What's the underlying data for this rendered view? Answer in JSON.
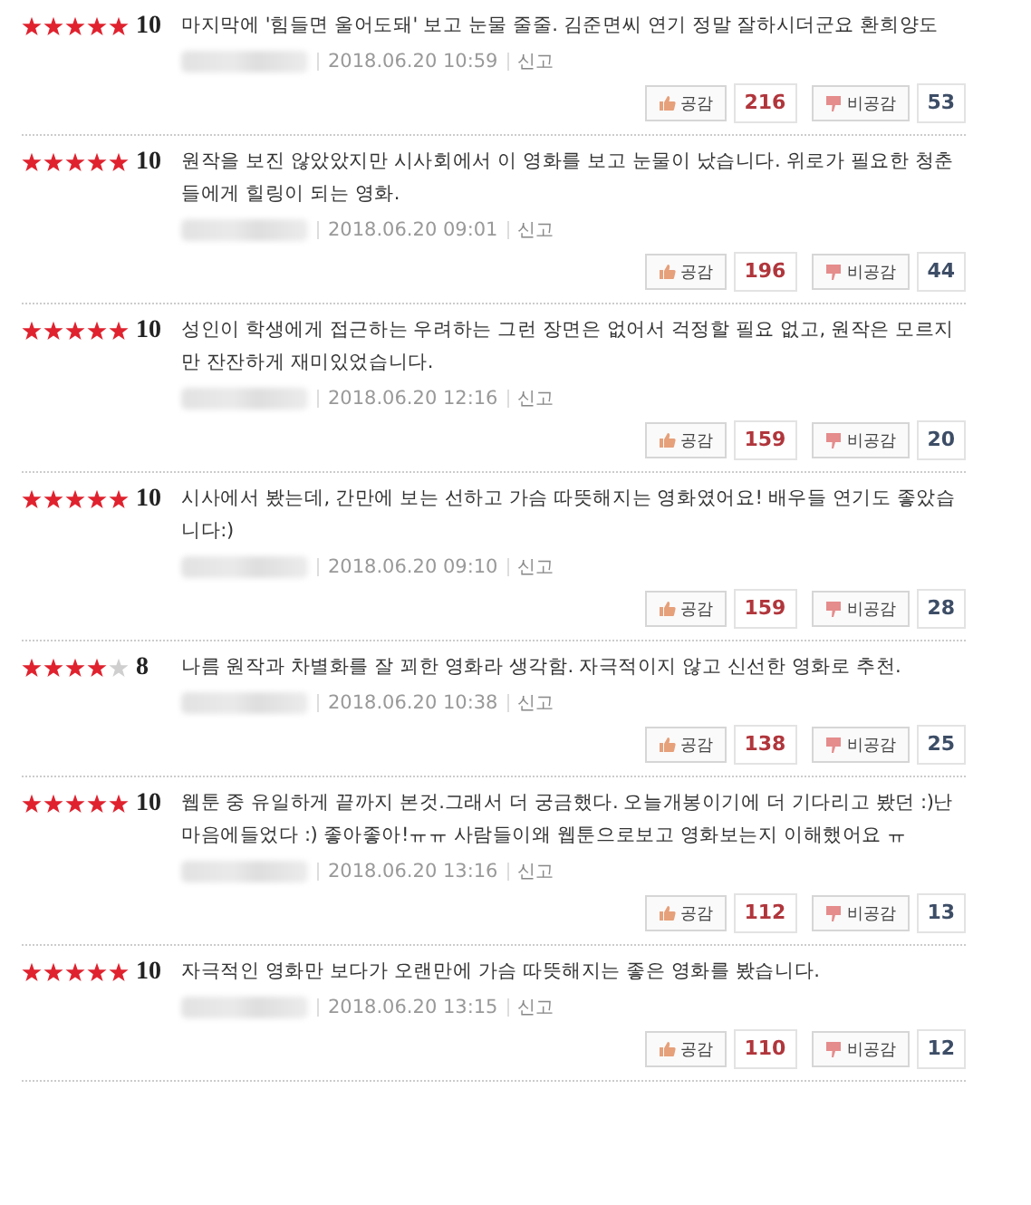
{
  "reviews": [
    {
      "stars": 5,
      "score": "10",
      "text": "마지막에 '힘들면 울어도돼' 보고 눈물 줄줄. 김준면씨 연기 정말 잘하시더군요 환희양도",
      "date": "2018.06.20 10:59",
      "report": "신고",
      "like_label": "공감",
      "likes": "216",
      "dislike_label": "비공감",
      "dislikes": "53"
    },
    {
      "stars": 5,
      "score": "10",
      "text": "원작을 보진 않았았지만 시사회에서 이 영화를 보고 눈물이 났습니다. 위로가 필요한 청춘들에게 힐링이 되는 영화.",
      "date": "2018.06.20 09:01",
      "report": "신고",
      "like_label": "공감",
      "likes": "196",
      "dislike_label": "비공감",
      "dislikes": "44"
    },
    {
      "stars": 5,
      "score": "10",
      "text": "성인이 학생에게 접근하는 우려하는 그런 장면은 없어서 걱정할 필요 없고, 원작은 모르지만 잔잔하게 재미있었습니다.",
      "date": "2018.06.20 12:16",
      "report": "신고",
      "like_label": "공감",
      "likes": "159",
      "dislike_label": "비공감",
      "dislikes": "20"
    },
    {
      "stars": 5,
      "score": "10",
      "text": "시사에서 봤는데, 간만에 보는 선하고 가슴 따뜻해지는 영화였어요! 배우들 연기도 좋았습니다:)",
      "date": "2018.06.20 09:10",
      "report": "신고",
      "like_label": "공감",
      "likes": "159",
      "dislike_label": "비공감",
      "dislikes": "28"
    },
    {
      "stars": 4,
      "score": "8",
      "text": "나름 원작과 차별화를 잘 꾀한 영화라 생각함. 자극적이지 않고 신선한 영화로 추천.",
      "date": "2018.06.20 10:38",
      "report": "신고",
      "like_label": "공감",
      "likes": "138",
      "dislike_label": "비공감",
      "dislikes": "25"
    },
    {
      "stars": 5,
      "score": "10",
      "text": "웹툰 중 유일하게 끝까지 본것.그래서 더 궁금했다. 오늘개봉이기에 더 기다리고 봤던 :)난 마음에들었다 :) 좋아좋아!ㅠㅠ 사람들이왜 웹툰으로보고 영화보는지 이해했어요 ㅠ",
      "date": "2018.06.20 13:16",
      "report": "신고",
      "like_label": "공감",
      "likes": "112",
      "dislike_label": "비공감",
      "dislikes": "13"
    },
    {
      "stars": 5,
      "score": "10",
      "text": "자극적인 영화만 보다가 오랜만에 가슴 따뜻해지는 좋은 영화를 봤습니다.",
      "date": "2018.06.20 13:15",
      "report": "신고",
      "like_label": "공감",
      "likes": "110",
      "dislike_label": "비공감",
      "dislikes": "12"
    }
  ]
}
